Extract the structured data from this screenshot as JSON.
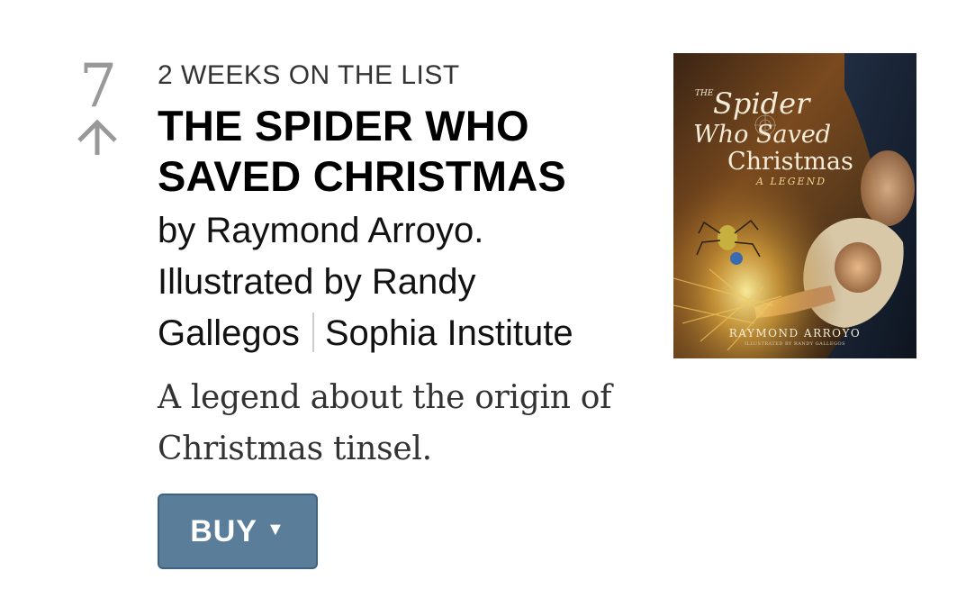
{
  "entry": {
    "rank": "7",
    "rank_trend_icon": "arrow-up-icon",
    "weeks_on_list": "2 weeks on the list",
    "title": "The Spider Who Saved Christmas",
    "byline": "by Raymond Arroyo. Illustrated by Randy Gallegos",
    "publisher": "Sophia Institute",
    "description": "A legend about the origin of Christmas tinsel.",
    "buy_label": "BUY",
    "buy_icon": "caret-down-icon"
  },
  "cover": {
    "title_prefix": "THE",
    "title_line1": "Spider",
    "title_line2": "Who Saved",
    "title_line3": "Christmas",
    "subtitle": "A LEGEND",
    "author": "RAYMOND ARROYO",
    "illustrator": "ILLUSTRATED BY RANDY GALLEGOS"
  },
  "colors": {
    "rank": "#999999",
    "button_bg": "#5a7d99",
    "button_border": "#3f6280",
    "divider": "#cccccc"
  }
}
